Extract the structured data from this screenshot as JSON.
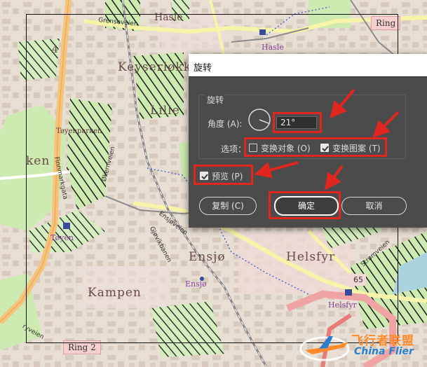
{
  "map": {
    "labels": {
      "hasle": "Hasle",
      "hasle_station": "Hasle",
      "ring_top": "Ring",
      "grenseveien": "Grenseveien",
      "keyserlokka": "Keyserløkka",
      "lille": "Lille",
      "tøyenparken": "Tøyenparken",
      "ken": "ken",
      "finnmarkgata": "Finnmarkgata",
      "okernveien": "Økernveien",
      "toyen": "Tøyen",
      "ensjoveien": "Ensjøveien",
      "gjorvikbanen": "Gjøvikbanen",
      "ensjo": "Ensjø",
      "ensjo_station": "Ensjø",
      "helsfyr": "Helsfyr",
      "helsfyr_station": "Helsfyr",
      "strommveien": "Strømveien",
      "kampen": "Kampen",
      "ring2": "Ring 2",
      "route65": "65",
      "ryveien": "ryveien",
      "number4": "4"
    }
  },
  "dialog": {
    "title": "旋转",
    "group_label": "旋转",
    "angle_label": "角度 (A):",
    "angle_value": "21°",
    "dial_angle_deg": 21,
    "options_label": "选项：",
    "transform_objects": {
      "label": "变换对象 (O)",
      "checked": false
    },
    "transform_patterns": {
      "label": "变换图案 (T)",
      "checked": true
    },
    "preview": {
      "label": "预览 (P)",
      "checked": true
    },
    "buttons": {
      "copy": "复制 (C)",
      "ok": "确定",
      "cancel": "取消"
    }
  },
  "watermark": {
    "cn": "飞行者联盟",
    "en": "China Flier"
  },
  "colors": {
    "dialog_bg": "#4b4b4b",
    "annotation_red": "#e0261e",
    "park_green": "#cdebb0",
    "hatch": "#1a1a1a",
    "road_orange": "#f7c27a",
    "road_yellow": "#f6f4a8",
    "railway": "#8a8a8a"
  }
}
